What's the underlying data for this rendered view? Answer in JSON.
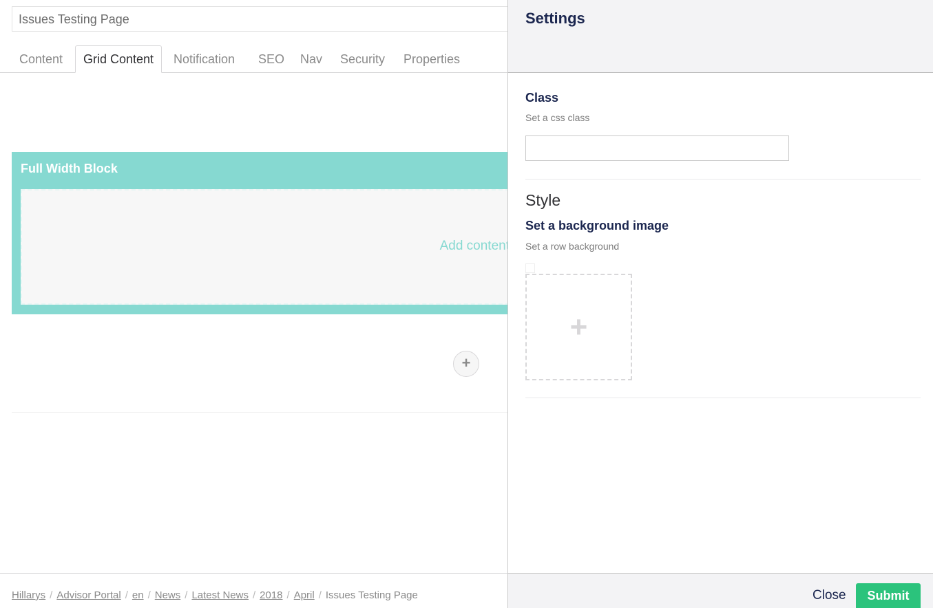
{
  "page": {
    "name": "Issues Testing Page"
  },
  "tabs": [
    {
      "label": "Content"
    },
    {
      "label": "Grid Content"
    },
    {
      "label": "Notification"
    },
    {
      "label": "SEO"
    },
    {
      "label": "Nav"
    },
    {
      "label": "Security"
    },
    {
      "label": "Properties"
    }
  ],
  "active_tab": "Grid Content",
  "grid": {
    "block_title": "Full Width Block",
    "add_content": "Add content",
    "add_row_icon": "+"
  },
  "breadcrumb": {
    "items": [
      "Hillarys",
      "Advisor Portal",
      "en",
      "News",
      "Latest News",
      "2018",
      "April"
    ],
    "current": "Issues Testing Page",
    "separator": "/"
  },
  "settings": {
    "title": "Settings",
    "class_label": "Class",
    "class_desc": "Set a css class",
    "class_value": "",
    "style_heading": "Style",
    "bg_label": "Set a background image",
    "bg_desc": "Set a row background",
    "add_image_icon": "+"
  },
  "footer": {
    "close_label": "Close",
    "submit_label": "Submit"
  },
  "colors": {
    "accent_teal": "#86d9d1",
    "submit_green": "#2bc37c",
    "text_dark": "#1b264f"
  }
}
